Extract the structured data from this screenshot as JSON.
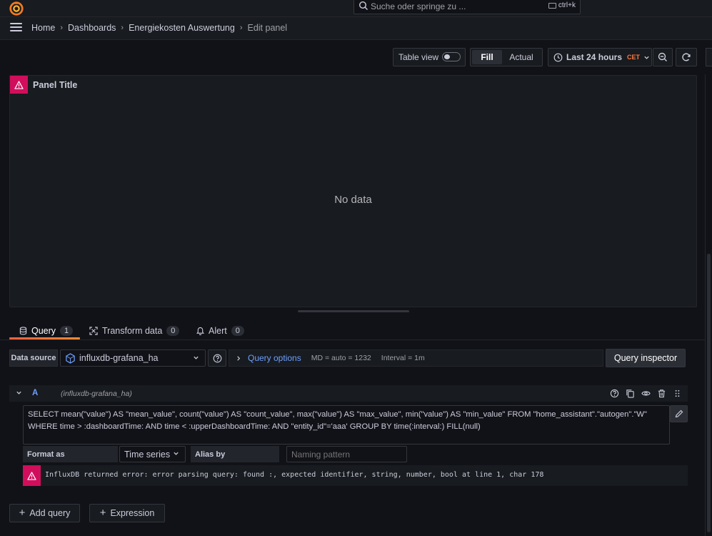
{
  "search": {
    "placeholder": "Suche oder springe zu ...",
    "shortcut": "ctrl+k"
  },
  "breadcrumb": [
    "Home",
    "Dashboards",
    "Energiekosten Auswertung",
    "Edit panel"
  ],
  "toolbar": {
    "table_view_label": "Table view",
    "table_view_on": false,
    "fill_label": "Fill",
    "actual_label": "Actual",
    "time_range": "Last 24 hours",
    "timezone": "CET"
  },
  "panel": {
    "title": "Panel Title",
    "no_data": "No data"
  },
  "tabs": [
    {
      "label": "Query",
      "count": "1"
    },
    {
      "label": "Transform data",
      "count": "0"
    },
    {
      "label": "Alert",
      "count": "0"
    }
  ],
  "datasource": {
    "label": "Data source",
    "name": "influxdb-grafana_ha",
    "query_options_label": "Query options",
    "md": "MD = auto = 1232",
    "interval": "Interval = 1m",
    "inspector_label": "Query inspector"
  },
  "query": {
    "ref_id": "A",
    "ds_name": "(influxdb-grafana_ha)",
    "text": "SELECT mean(\"value\") AS \"mean_value\", count(\"value\") AS \"count_value\", max(\"value\") AS \"max_value\", min(\"value\") AS \"min_value\" FROM \"home_assistant\".\"autogen\".\"W\"\nWHERE time > :dashboardTime: AND time < :upperDashboardTime: AND \"entity_id\"='aaa' GROUP BY time(:interval:) FILL(null)",
    "format_label": "Format as",
    "format_value": "Time series",
    "alias_label": "Alias by",
    "alias_placeholder": "Naming pattern",
    "error": "InfluxDB returned error: error parsing query: found :, expected identifier, string, number, bool at line 1, char 178"
  },
  "buttons": {
    "add_query": "Add query",
    "expression": "Expression"
  },
  "colors": {
    "error": "#d10e5c",
    "link": "#6e9fff",
    "accent": "#ff7941"
  }
}
